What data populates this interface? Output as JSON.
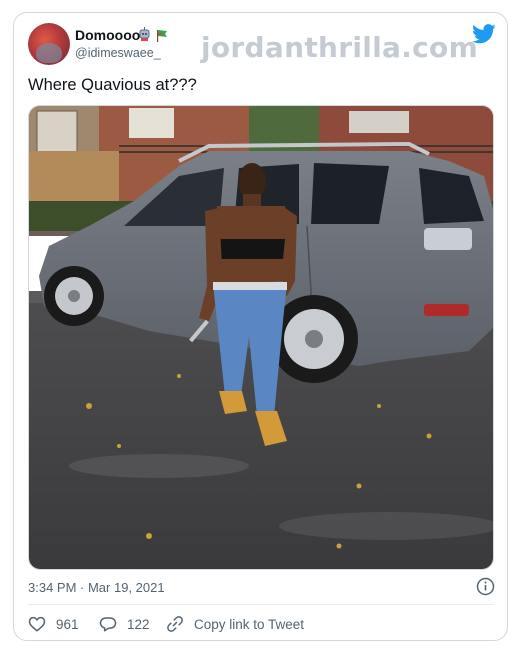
{
  "tweet": {
    "display_name": "Domoooo",
    "handle": "@idimeswaee_",
    "text": "Where Quavious at???",
    "timestamp": "3:34 PM · Mar 19, 2021",
    "name_emojis": [
      "robot-emoji",
      "flag-emoji"
    ]
  },
  "watermark": "jordanthrilla.com",
  "actions": {
    "like_count": "961",
    "reply_count": "122",
    "copy_label": "Copy link to Tweet"
  },
  "colors": {
    "twitter_blue": "#1d9bf0",
    "text_primary": "#0f1419",
    "text_secondary": "#536471",
    "border": "#cfd9de"
  },
  "icons": [
    "twitter-bird-icon",
    "info-icon",
    "heart-icon",
    "reply-icon",
    "link-icon"
  ]
}
